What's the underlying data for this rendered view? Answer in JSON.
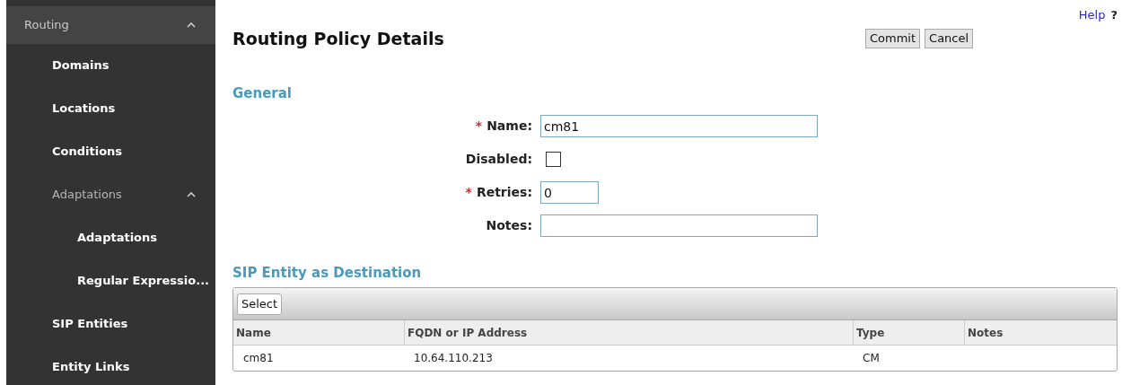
{
  "sidebar": {
    "label": "Routing",
    "expanded": true,
    "children": [
      {
        "label": "Domains"
      },
      {
        "label": "Locations"
      },
      {
        "label": "Conditions"
      },
      {
        "label": "Adaptations",
        "expanded": true,
        "children": [
          {
            "label": "Adaptations"
          },
          {
            "label": "Regular Expressio..."
          }
        ]
      },
      {
        "label": "SIP Entities"
      },
      {
        "label": "Entity Links"
      }
    ]
  },
  "help": {
    "label": "Help",
    "icon": "?"
  },
  "title": "Routing Policy Details",
  "buttons": [
    "Commit",
    "Cancel"
  ],
  "general": {
    "heading": "General",
    "fields": [
      {
        "kind": "text",
        "label": "Name:",
        "required_mark": "*",
        "value": "cm81"
      },
      {
        "kind": "checkbox",
        "label": "Disabled:",
        "checked": false
      },
      {
        "kind": "number",
        "label": "Retries:",
        "required_mark": "*",
        "value": "0"
      },
      {
        "kind": "text",
        "label": "Notes:"
      }
    ]
  },
  "destination": {
    "heading": "SIP Entity as Destination",
    "select_button": "Select",
    "table": {
      "columns": [
        "Name",
        "FQDN or IP Address",
        "Type",
        "Notes"
      ],
      "rows": [
        [
          "cm81",
          "10.64.110.213",
          "CM"
        ]
      ]
    }
  }
}
